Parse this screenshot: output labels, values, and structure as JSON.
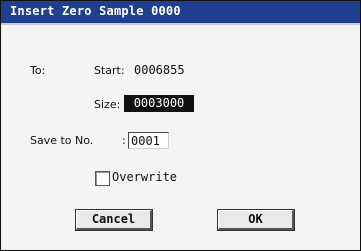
{
  "dialog": {
    "title": "Insert Zero Sample 0000"
  },
  "fields": {
    "to_label": "To:",
    "start_label": "Start:",
    "start_value": "0006855",
    "size_label": "Size:",
    "size_value": "0003000",
    "save_label": "Save to No.",
    "save_colon": ":",
    "save_value": "0001"
  },
  "overwrite": {
    "label": "Overwrite",
    "checked": false
  },
  "buttons": {
    "cancel": "Cancel",
    "ok": "OK"
  },
  "colors": {
    "titlebar": "#1f3f90",
    "dialog_bg": "#f4f4f4",
    "selected_field_bg": "#111111"
  }
}
